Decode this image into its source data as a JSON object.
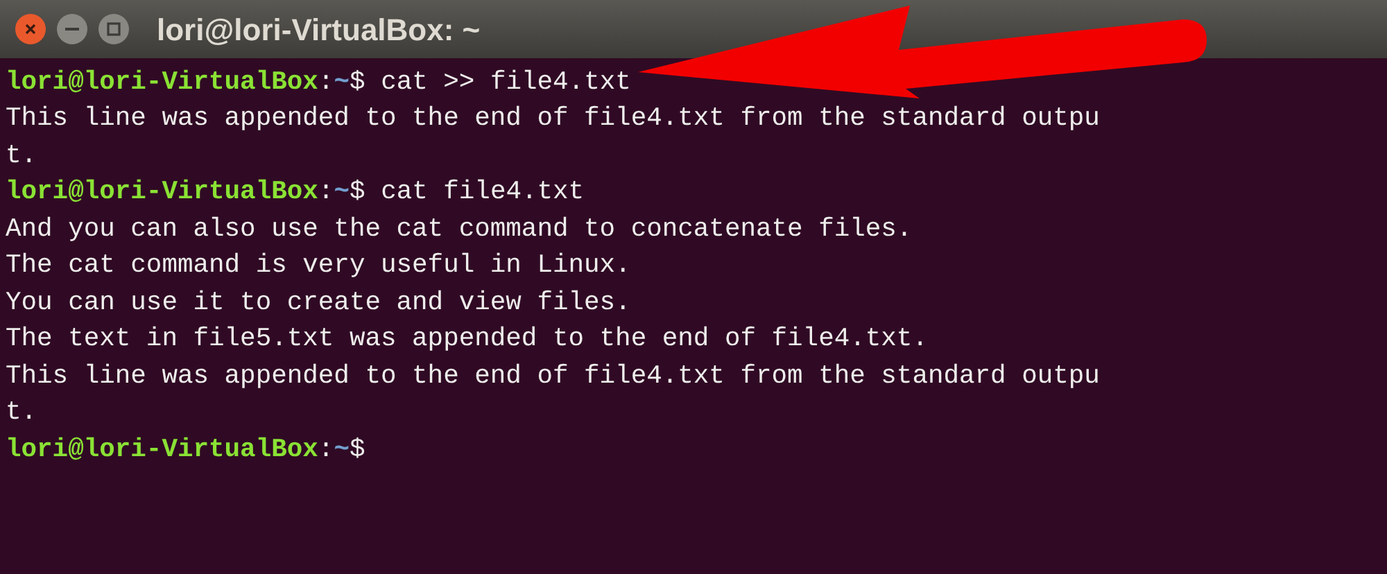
{
  "window": {
    "title": "lori@lori-VirtualBox: ~"
  },
  "terminal": {
    "lines": [
      {
        "kind": "prompt",
        "user_host": "lori@lori-VirtualBox",
        "separator": ":",
        "path": "~",
        "symbol": "$",
        "command": "cat >> file4.txt"
      },
      {
        "kind": "output",
        "text": "This line was appended to the end of file4.txt from the standard outpu"
      },
      {
        "kind": "output",
        "text": "t."
      },
      {
        "kind": "prompt",
        "user_host": "lori@lori-VirtualBox",
        "separator": ":",
        "path": "~",
        "symbol": "$",
        "command": "cat file4.txt"
      },
      {
        "kind": "output",
        "text": "And you can also use the cat command to concatenate files."
      },
      {
        "kind": "output",
        "text": "The cat command is very useful in Linux."
      },
      {
        "kind": "output",
        "text": "You can use it to create and view files."
      },
      {
        "kind": "output",
        "text": "The text in file5.txt was appended to the end of file4.txt."
      },
      {
        "kind": "output",
        "text": "This line was appended to the end of file4.txt from the standard outpu"
      },
      {
        "kind": "output",
        "text": "t."
      },
      {
        "kind": "prompt",
        "user_host": "lori@lori-VirtualBox",
        "separator": ":",
        "path": "~",
        "symbol": "$"
      }
    ]
  }
}
